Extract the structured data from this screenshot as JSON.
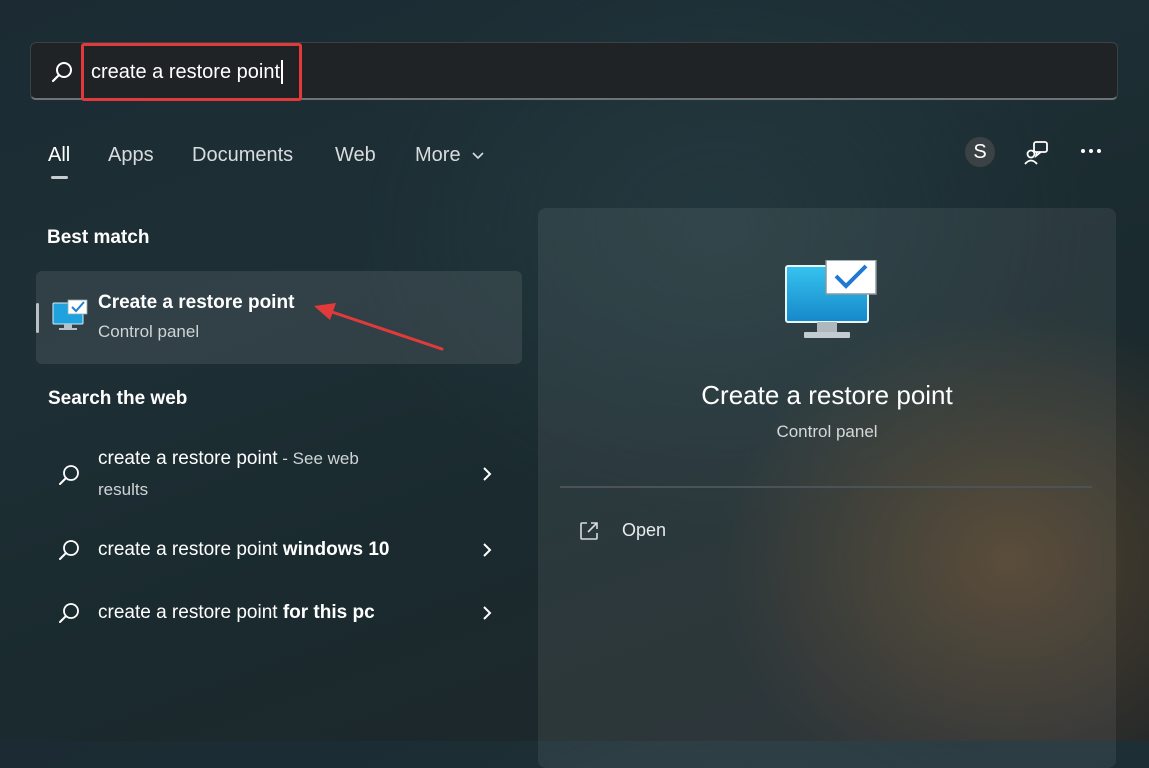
{
  "search": {
    "query": "create a restore point"
  },
  "tabs": [
    {
      "label": "All"
    },
    {
      "label": "Apps"
    },
    {
      "label": "Documents"
    },
    {
      "label": "Web"
    },
    {
      "label": "More"
    }
  ],
  "header_right": {
    "avatar_letter": "S",
    "feedback_icon": "feedback-icon",
    "more_icon": "ellipsis-icon"
  },
  "best_match": {
    "section_title": "Best match",
    "title": "Create a restore point",
    "subtitle": "Control panel",
    "icon": "monitor-check-icon"
  },
  "web": {
    "section_title": "Search the web",
    "items": [
      {
        "prefix": "create a restore point",
        "bold": "",
        "suffix": " - See web",
        "suffix2": "results"
      },
      {
        "prefix": "create a restore point ",
        "bold": "windows 10",
        "suffix": "",
        "suffix2": ""
      },
      {
        "prefix": "create a restore point ",
        "bold": "for this pc",
        "suffix": "",
        "suffix2": ""
      }
    ]
  },
  "preview": {
    "title": "Create a restore point",
    "subtitle": "Control panel",
    "actions": [
      {
        "label": "Open",
        "icon": "open-external-icon"
      }
    ]
  },
  "colors": {
    "highlight_box": "#e23a3a",
    "annotation_arrow": "#e23a3a",
    "monitor_blue": "#1fa3df"
  }
}
